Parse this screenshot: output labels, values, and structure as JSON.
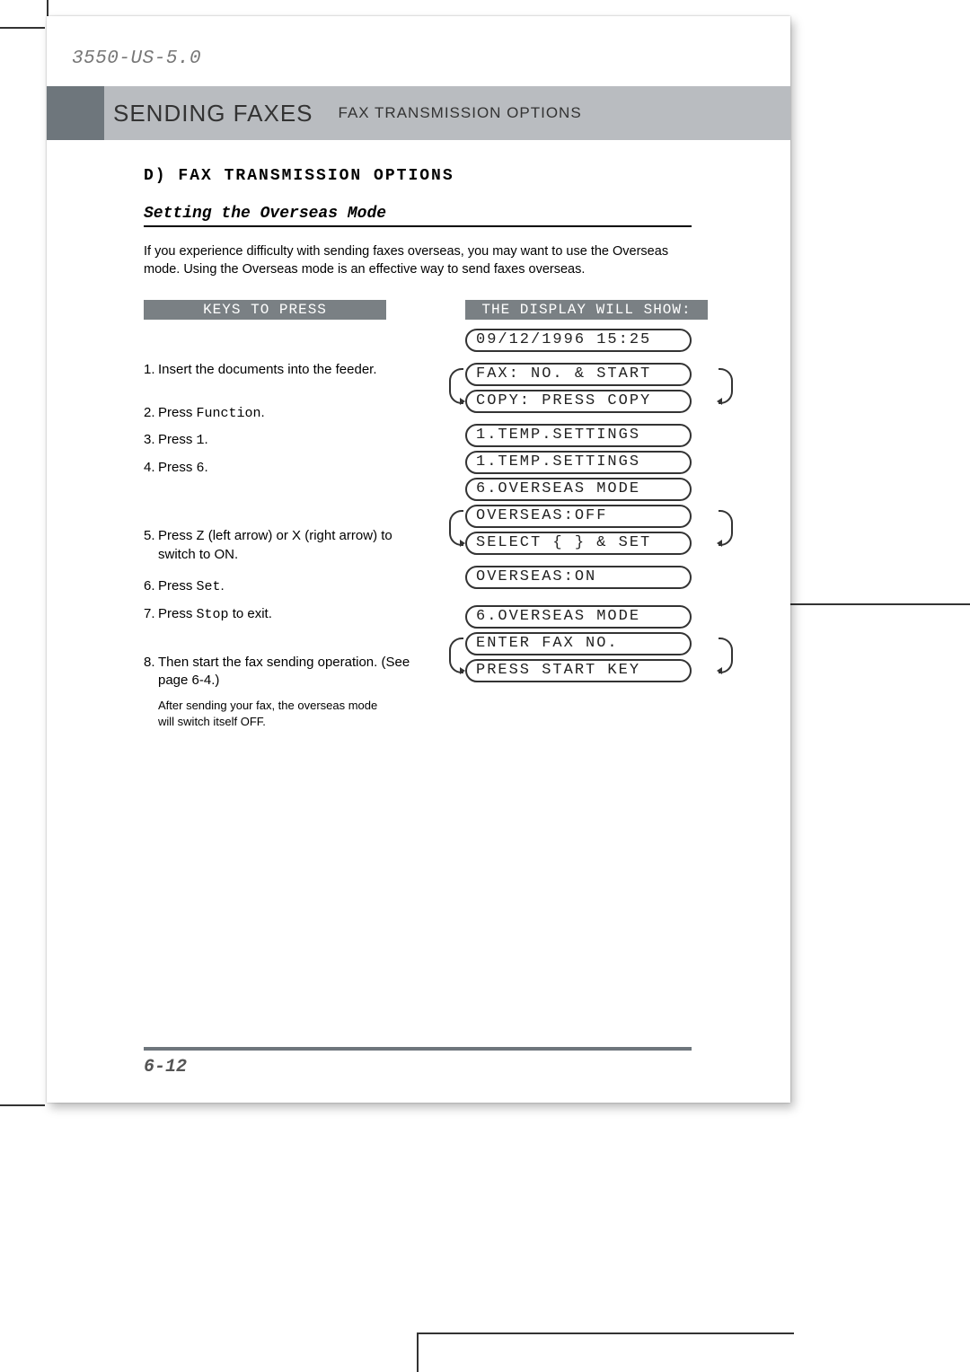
{
  "doc_id": "3550-US-5.0",
  "header": {
    "title": "SENDING FAXES",
    "subtitle": "FAX TRANSMISSION OPTIONS"
  },
  "section": {
    "letter": "D)  FAX  TRANSMISSION  OPTIONS",
    "subheading": "Setting the Overseas Mode",
    "intro": "If  you experience  difficulty  with  sending  faxes  overseas,  you may want to use the Overseas mode. Using  the  Overseas  mode is  an effective  way to send faxes  overseas."
  },
  "columns": {
    "left_head": "KEYS TO PRESS",
    "right_head": "THE DISPLAY WILL SHOW:"
  },
  "steps": [
    {
      "n": "1.",
      "pre": "Insert  the documents into the ",
      "mono": "",
      "post": "feeder."
    },
    {
      "n": "2.",
      "pre": "Press  ",
      "mono": "Function",
      "post": "."
    },
    {
      "n": "3.",
      "pre": "Press  ",
      "mono": "1",
      "post": "."
    },
    {
      "n": "4.",
      "pre": "Press  ",
      "mono": "6",
      "post": "."
    },
    {
      "n": "5.",
      "pre": "Press  ",
      "mono": "Z",
      "post": " (left  arrow)  or  X (right arrow)  to switch  to ON."
    },
    {
      "n": "6.",
      "pre": "Press  ",
      "mono": "Set",
      "post": "."
    },
    {
      "n": "7.",
      "pre": "Press  ",
      "mono": "Stop",
      "post": " to exit."
    },
    {
      "n": "8.",
      "pre": "Then start the fax sending operation.  (See page 6-4.)",
      "mono": "",
      "post": ""
    }
  ],
  "note": "After  sending  your fax,  the overseas  mode will  switch  itself  OFF.",
  "lcd": {
    "l0": "09/12/1996  15:25",
    "l1": "FAX: NO. & START",
    "l2": "COPY: PRESS COPY",
    "l3": "1.TEMP.SETTINGS",
    "l4": "1.TEMP.SETTINGS",
    "l5": "6.OVERSEAS  MODE",
    "l6": "OVERSEAS:OFF",
    "l7": "SELECT { } & SET",
    "l8": "OVERSEAS:ON",
    "l9": "6.OVERSEAS  MODE",
    "l10": "ENTER FAX NO.",
    "l11": "PRESS START KEY"
  },
  "page_number": "6-12"
}
